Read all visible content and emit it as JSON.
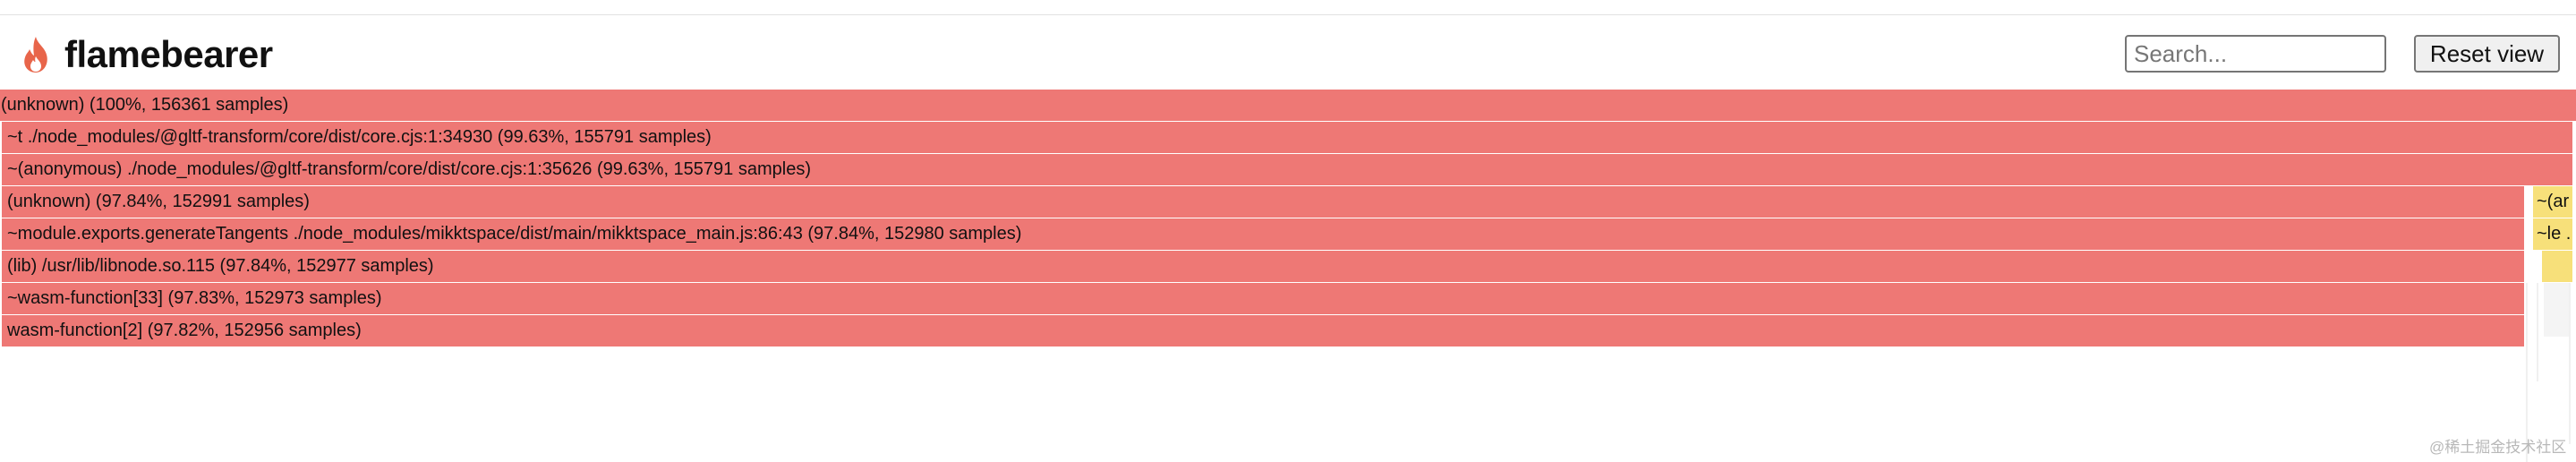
{
  "app": {
    "brand": "flamebearer",
    "logo_icon": "flame-icon"
  },
  "toolbar": {
    "search_placeholder": "Search...",
    "search_value": "",
    "reset_label": "Reset view"
  },
  "colors": {
    "frame_red": "#ee7875",
    "frame_yellow": "#f7e07a",
    "logo_flame": "#e8654a"
  },
  "frames": [
    {
      "label": "(unknown) (100%, 156361 samples)",
      "percent": 100,
      "samples": 156361,
      "depth": 0
    },
    {
      "label": "~t ./node_modules/@gltf-transform/core/dist/core.cjs:1:34930 (99.63%, 155791 samples)",
      "percent": 99.63,
      "samples": 155791,
      "depth": 1
    },
    {
      "label": "~(anonymous) ./node_modules/@gltf-transform/core/dist/core.cjs:1:35626 (99.63%, 155791 samples)",
      "percent": 99.63,
      "samples": 155791,
      "depth": 2
    },
    {
      "label": "(unknown) (97.84%, 152991 samples)",
      "percent": 97.84,
      "samples": 152991,
      "depth": 3
    },
    {
      "label": "~module.exports.generateTangents ./node_modules/mikktspace/dist/main/mikktspace_main.js:86:43 (97.84%, 152980 samples)",
      "percent": 97.84,
      "samples": 152980,
      "depth": 4
    },
    {
      "label": "(lib) /usr/lib/libnode.so.115 (97.84%, 152977 samples)",
      "percent": 97.84,
      "samples": 152977,
      "depth": 5
    },
    {
      "label": "~wasm-function[33] (97.83%, 152973 samples)",
      "percent": 97.83,
      "samples": 152973,
      "depth": 6
    },
    {
      "label": "wasm-function[2] (97.82%, 152956 samples)",
      "percent": 97.82,
      "samples": 152956,
      "depth": 7
    }
  ],
  "side_frames": [
    {
      "label": "~(ar",
      "depth": 3
    },
    {
      "label": "~le ..",
      "depth": 4
    },
    {
      "label": "",
      "depth": 5
    }
  ],
  "watermark": "@稀土掘金技术社区"
}
